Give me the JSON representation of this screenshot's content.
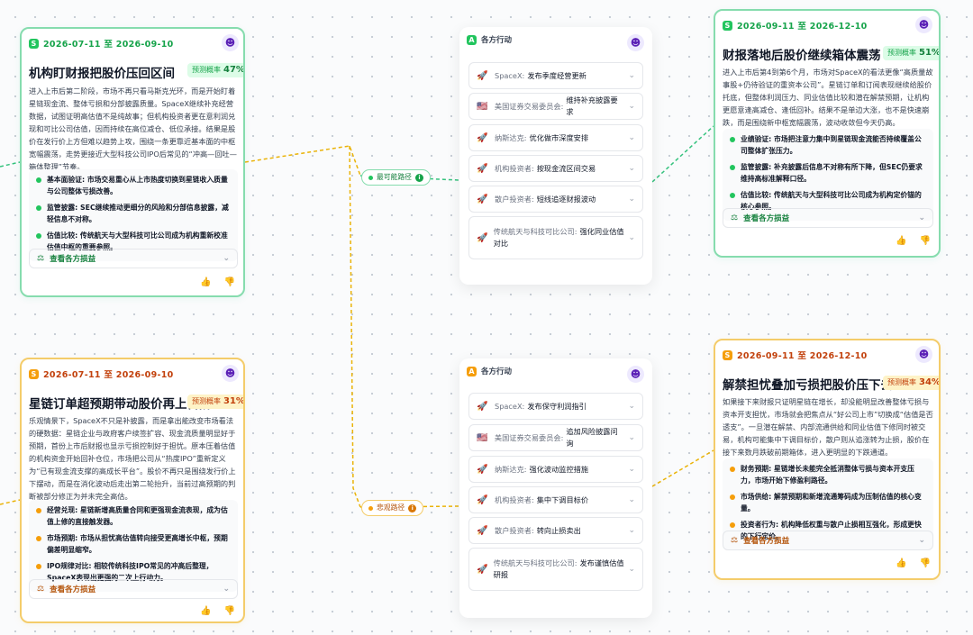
{
  "colors": {
    "green": "#22c55e",
    "orange": "#f59e0b",
    "link_green": "#34c27d",
    "link_orange": "#eab308"
  },
  "cards": [
    {
      "date": "2026-07-11 至 2026-09-10",
      "title": "机构盯财报把股价压回区间",
      "prob_label": "预测概率",
      "prob_value": "47%",
      "paragraph": "进入上市后第二阶段，市场不再只看马斯克光环，而是开始盯着星链现金流、整体亏损和分部披露质量。SpaceX继续补充经营数据，试图证明高估值不是纯故事；但机构投资者更在意利润兑现和可比公司估值，因而持续在高位减仓、低位承接。结果是股价在发行价上方但难以趋势上攻，围绕一条更靠近基本面的中枢宽幅震荡，走势更接近大型科技公司IPO后常见的“冲高—回吐—箱体整理”节奏。",
      "bullets": [
        "基本面验证: 市场交易重心从上市热度切换到星链收入质量与公司整体亏损改善。",
        "监管披露: SEC继续推动更细分的风险和分部信息披露，减轻信息不对称。",
        "估值比较: 传统航天与大型科技可比公司成为机构重新校准估值中枢的重要参照。"
      ],
      "expand": "查看各方损益"
    },
    {
      "date": "2026-07-11 至 2026-09-10",
      "title": "星链订单超预期带动股价再上台阶",
      "prob_label": "预测概率",
      "prob_value": "31%",
      "paragraph": "乐观情景下，SpaceX不只是补披露，而是拿出能改变市场看法的硬数据：星链企业与政府客户续签扩容、现金流质量明显好于预期，首份上市后财报也显示亏损控制好于担忧。原本压着估值的机构资金开始回补仓位，市场把公司从“热度IPO”重新定义为“已有现金流支撑的高成长平台”。股价不再只是围绕发行价上下摆动，而是在消化波动后走出第二轮抬升，当前过高预期的判断被部分修正为并未完全高估。",
      "bullets": [
        "经营兑现: 星链新增高质量合同和更强现金流表现，成为估值上修的直接触发器。",
        "市场预期: 市场从担忧高估值转向接受更高增长中枢，预期偏差明显缩窄。",
        "IPO规律对比: 相较传统科技IPO常见的冲高后整理，SpaceX表现出更强的二次上行动力。"
      ],
      "expand": "查看各方损益"
    },
    {
      "date": "2026-09-11 至 2026-12-10",
      "title": "财报落地后股价继续箱体震荡",
      "prob_label": "预测概率",
      "prob_value": "51%",
      "paragraph": "进入上市后第4到第6个月，市场对SpaceX的看法更像“高质量故事股+仍待验证的重资本公司”。星链订单和订阅表现继续给股价托底，但整体利润压力、同业估值比较和潜在解禁预期，让机构更愿意逢高减仓、逢低回补。结果不是单边大涨，也不是快速崩跌，而是围绕新中枢宽幅震荡，波动收敛但今天仍高。",
      "bullets": [
        "业绩验证: 市场把注意力集中到星链现金流能否持续覆盖公司整体扩张压力。",
        "监管披露: 补充披露后信息不对称有所下降，但SEC仍要求维持高标准解释口径。",
        "估值比较: 传统航天与大型科技可比公司成为机构定价锚的核心参照。"
      ],
      "expand": "查看各方损益"
    },
    {
      "date": "2026-09-11 至 2026-12-10",
      "title": "解禁担忧叠加亏损把股价压下去",
      "prob_label": "预测概率",
      "prob_value": "34%",
      "paragraph": "如果接下来财报只证明星链在增长，却没能明显改善整体亏损与资本开支担忧，市场就会把焦点从“好公司上市”切换成“估值是否透支”。一旦潜在解禁、内部流通供给和同业估值下修同时被交易，机构可能集中下调目标价，散户则从追涨转为止损，股价在接下来数月跌破前期箱体，进入更明显的下跌通道。",
      "bullets": [
        "财务预期: 星链增长未能完全抵消整体亏损与资本开支压力，市场开始下修盈利路径。",
        "市场供给: 解禁预期和新增流通筹码成为压制估值的核心变量。",
        "投资者行为: 机构降低权重与散户止损相互强化，形成更快的下行定价。"
      ],
      "expand": "查看各方损益"
    }
  ],
  "panels": [
    {
      "header": "各方行动",
      "rows": [
        {
          "flag": "🚀",
          "who": "SpaceX:",
          "act": "发布季度经营更新"
        },
        {
          "flag": "🇺🇸",
          "who": "美国证券交易委员会:",
          "act": "维持补充披露要求"
        },
        {
          "flag": "🚀",
          "who": "纳斯达克:",
          "act": "优化做市深度安排"
        },
        {
          "flag": "🚀",
          "who": "机构投资者:",
          "act": "按现金流区间交易"
        },
        {
          "flag": "🚀",
          "who": "散户投资者:",
          "act": "短线追逐财报波动"
        },
        {
          "flag": "🚀",
          "who": "传统航天与科技可比公司:",
          "act": "强化同业估值对比"
        }
      ]
    },
    {
      "header": "各方行动",
      "rows": [
        {
          "flag": "🚀",
          "who": "SpaceX:",
          "act": "发布保守利润指引"
        },
        {
          "flag": "🇺🇸",
          "who": "美国证券交易委员会:",
          "act": "追加风险披露问询"
        },
        {
          "flag": "🚀",
          "who": "纳斯达克:",
          "act": "强化波动监控措施"
        },
        {
          "flag": "🚀",
          "who": "机构投资者:",
          "act": "集中下调目标价"
        },
        {
          "flag": "🚀",
          "who": "散户投资者:",
          "act": "转向止损卖出"
        },
        {
          "flag": "🚀",
          "who": "传统航天与科技可比公司:",
          "act": "发布谨慎估值研报"
        }
      ]
    }
  ],
  "pills": [
    {
      "label": "最可能路径",
      "info": "i"
    },
    {
      "label": "悲观路径",
      "info": "i"
    }
  ],
  "icons": {
    "bot": "robot-icon",
    "thumb_up": "thumbs-up-icon",
    "thumb_down": "thumbs-down-icon",
    "scale": "scale-icon",
    "chevron": "chevron-down-icon"
  }
}
